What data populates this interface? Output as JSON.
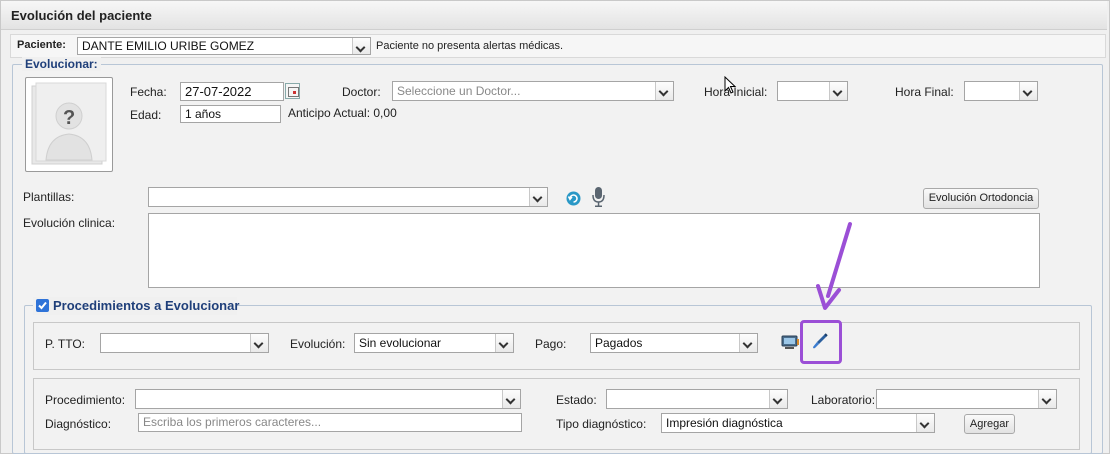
{
  "window": {
    "title": "Evolución del paciente"
  },
  "patient": {
    "label": "Paciente:",
    "name": "DANTE EMILIO URIBE GOMEZ",
    "alert": "Paciente no presenta alertas médicas."
  },
  "evolve": {
    "legend": "Evolucionar:",
    "fecha_label": "Fecha:",
    "fecha_value": "27-07-2022",
    "doctor_label": "Doctor:",
    "doctor_placeholder": "Seleccione un Doctor...",
    "hora_inicial_label": "Hora Inicial:",
    "hora_final_label": "Hora Final:",
    "edad_label": "Edad:",
    "edad_value": "1 años",
    "anticipo_label": "Anticipo Actual: 0,00",
    "plantillas_label": "Plantillas:",
    "evolucion_ortodoncia_label": "Evolución Ortodoncia",
    "evolucion_clinica_label": "Evolución clinica:"
  },
  "procedures": {
    "legend": "Procedimientos a Evolucionar",
    "checked": true,
    "ptto_label": "P. TTO:",
    "evolucion_label": "Evolución:",
    "evolucion_value": "Sin evolucionar",
    "pago_label": "Pago:",
    "pago_value": "Pagados",
    "procedimiento_label": "Procedimiento:",
    "estado_label": "Estado:",
    "laboratorio_label": "Laboratorio:",
    "diagnostico_label": "Diagnóstico:",
    "diagnostico_placeholder": "Escriba los primeros caracteres...",
    "tipo_diagnostico_label": "Tipo diagnóstico:",
    "tipo_diagnostico_value": "Impresión diagnóstica",
    "agregar_label": "Agregar"
  },
  "colors": {
    "highlight": "#9b4fd6",
    "legend_text": "#1f3f7a"
  }
}
